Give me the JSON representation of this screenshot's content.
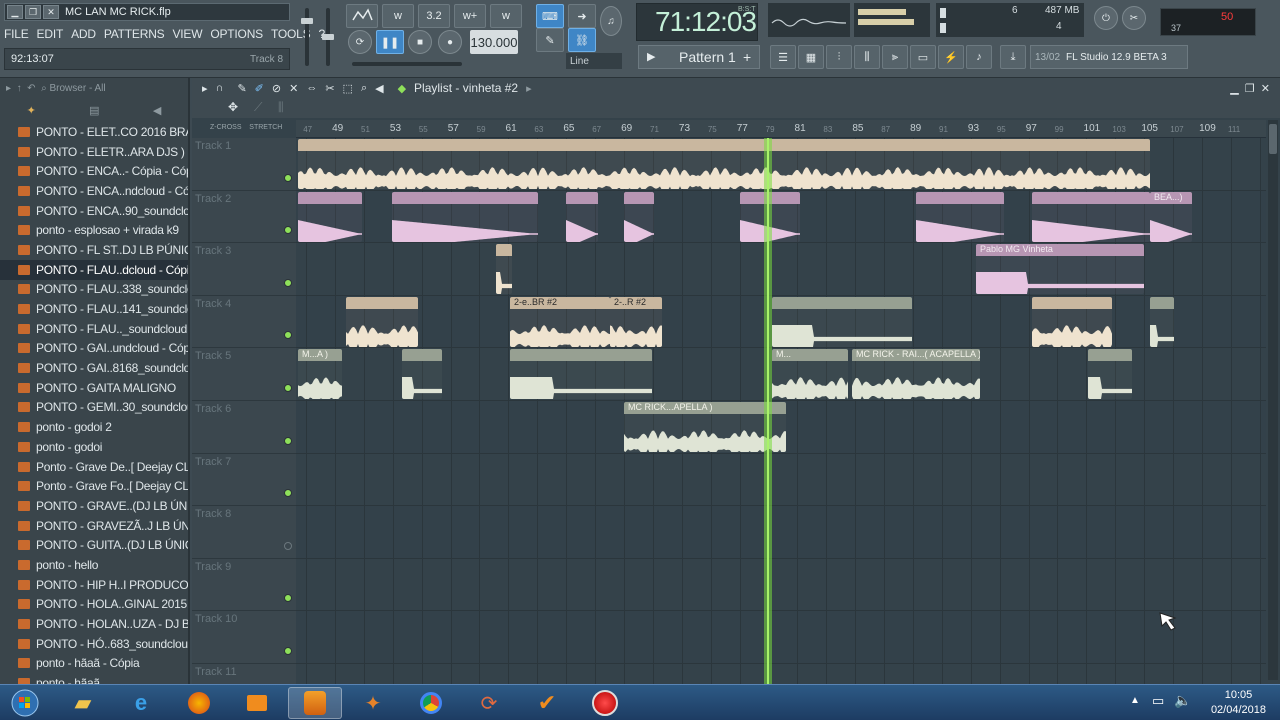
{
  "window": {
    "title": "MC LAN MC RICK.flp",
    "menu": [
      "FILE",
      "EDIT",
      "ADD",
      "PATTERNS",
      "VIEW",
      "OPTIONS",
      "TOOLS",
      "?"
    ],
    "hint_time": "92:13:07",
    "hint_track": "Track 8"
  },
  "transport": {
    "tempo": "130.000",
    "time": "71:12:03",
    "time_label": "B:S:T",
    "snap": "Line",
    "pattern": "Pattern 1",
    "cpu_mem": "487 MB",
    "cpu_value_1": "6",
    "cpu_value_2": "4",
    "hint_date": "13/02",
    "hint_version": "FL Studio 12.9 BETA 3",
    "toolbar_labels": [
      "3.2",
      "w+",
      "w"
    ]
  },
  "browser": {
    "header": "Browser - All",
    "items": [
      "PONTO - ELET..CO 2016 BRABO",
      "PONTO - ELETR..ARA DJS ) 2016",
      "PONTO - ENCA..- Cópia - Cópia",
      "PONTO - ENCA..ndcloud - Cópia",
      "PONTO - ENCA..90_soundcloud",
      "ponto - esplosao + virada k9",
      "PONTO - FL ST..DJ LB PÚNICO))",
      "PONTO - FLAU..dcloud - Cópia",
      "PONTO - FLAU..338_soundcloud",
      "PONTO - FLAU..141_soundcloud",
      "PONTO - FLAU.._soundcloud (1)",
      "PONTO - GAI..undcloud - Cópia",
      "PONTO - GAI..8168_soundcloud",
      "PONTO - GAITA MALIGNO",
      "PONTO - GEMI..30_soundcloud",
      "ponto - godoi  2",
      "ponto - godoi",
      "Ponto - Grave De..[ Deejay CL ])",
      "Ponto - Grave Fo..[ Deejay CL ])",
      "PONTO - GRAVE..(DJ LB ÚNICO))",
      "PONTO - GRAVEZÃ..J LB ÚNICO))",
      "PONTO - GUITA..(DJ LB ÚNICO))",
      "ponto - hello",
      "PONTO - HIP H..I PRODUCOES)",
      "PONTO - HOLA..GINAL 2015 ]]]",
      "PONTO - HOLAN..UZA - DJ BR22",
      "PONTO - HÓ..683_soundcloud",
      "ponto - hãaã - Cópia",
      "ponto - hãaã"
    ],
    "selected_index": 7
  },
  "playlist": {
    "title": "Playlist - vinheta #2",
    "ruler_major": [
      "47",
      "49",
      "51",
      "53",
      "55",
      "57",
      "59",
      "61",
      "63",
      "65",
      "67",
      "69",
      "71",
      "73",
      "75",
      "77",
      "79",
      "81",
      "83",
      "85",
      "87",
      "89",
      "91",
      "93",
      "95",
      "97",
      "99",
      "101",
      "103",
      "105",
      "107",
      "109",
      "111"
    ],
    "tracks": [
      "Track 1",
      "Track 2",
      "Track 3",
      "Track 4",
      "Track 5",
      "Track 6",
      "Track 7",
      "Track 8",
      "Track 9",
      "Track 10",
      "Track 11"
    ],
    "clip_labels": {
      "t3": "Pablo MG Vinheta",
      "t4a": "2-e..BR #2",
      "t4b": "2-..R #2",
      "t5a": "M...A )",
      "t5b": "M...",
      "t5c": "MC RICK - RAI...( ACAPELLA )",
      "t6": "MC RICK...APELLA )",
      "t6b": "M...)",
      "t2end": "BEA...)"
    }
  },
  "taskbar": {
    "time": "10:05",
    "date": "02/04/2018"
  }
}
